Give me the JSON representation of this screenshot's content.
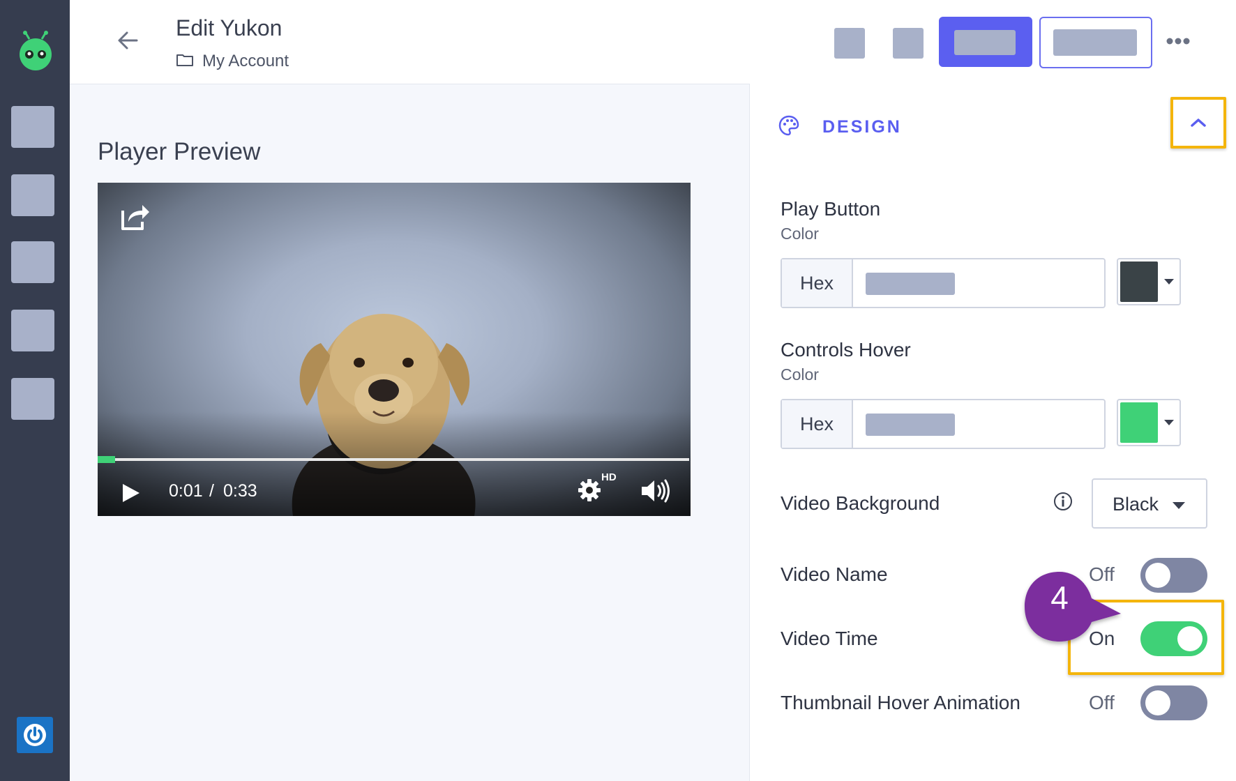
{
  "header": {
    "title": "Edit Yukon",
    "breadcrumb": "My Account"
  },
  "preview": {
    "title": "Player Preview",
    "time_current": "0:01",
    "time_separator": "/",
    "time_total": "0:33",
    "quality_badge": "HD",
    "progress_fraction": 0.03
  },
  "design": {
    "section_title": "DESIGN",
    "accent_color": "#5b5ff0",
    "play_button": {
      "label": "Play Button",
      "sub": "Color",
      "prefix": "Hex",
      "swatch_color": "#3a4347"
    },
    "controls_hover": {
      "label": "Controls Hover",
      "sub": "Color",
      "prefix": "Hex",
      "swatch_color": "#3fd177"
    },
    "video_background": {
      "label": "Video Background",
      "value": "Black"
    },
    "toggles": [
      {
        "label": "Video Name",
        "state": "Off"
      },
      {
        "label": "Video Time",
        "state": "On"
      },
      {
        "label": "Thumbnail Hover Animation",
        "state": "Off"
      }
    ]
  },
  "annotation": {
    "step": "4",
    "highlight_color": "#f4b50c",
    "bubble_color": "#7b2f9e"
  }
}
